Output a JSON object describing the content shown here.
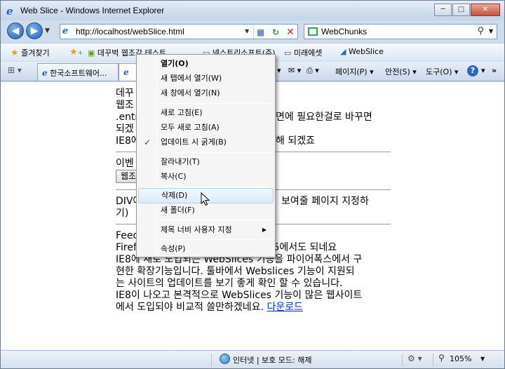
{
  "window": {
    "title": "Web Slice - Windows Internet Explorer",
    "min_label": "─",
    "max_label": "□",
    "close_label": "✕"
  },
  "nav": {
    "back_glyph": "◀",
    "fwd_glyph": "▶",
    "url": "http://localhost/webSlice.html",
    "search_provider": "WebChunks"
  },
  "favbar": {
    "favorites_label": "즐겨찾기",
    "items": [
      "데꾸벅 웹조각 테스트",
      "넥스트리소프트(주)",
      "미래에셋",
      "WebSlice"
    ]
  },
  "tabs": [
    {
      "label": "한국소프트웨어..."
    },
    {
      "label": ""
    }
  ],
  "commands": {
    "page": "페이지(P)",
    "safety": "안전(S)",
    "tools": "도구(O)",
    "help": "?"
  },
  "content": {
    "para1": [
      "데꾸",
      "웹조",
      ".entr",
      "되겠",
      "IE8에"
    ],
    "para1_right": [
      "면에 필요한걸로 바꾸면",
      "해 되겠죠"
    ],
    "para2": "이벤",
    "para2_btn": "웹조",
    "para3": [
      "DIV에",
      "기)"
    ],
    "para3_right": "보여줄 페이지 지정하",
    "para4": [
      "Feed",
      "Firef"
    ],
    "para4_right": ".5에서도 되네요",
    "para5": [
      "IE8에 새로 도입되는 WebSlices 기능을 파이어폭스에서 구",
      "현한 확장기능입니다. 툴바에서 Webslices 기능이 지원되",
      "는 사이트의 업데이트를 보기 좋게 확인 할 수 있습니다.",
      "IE8이 나오고 본격적으로 WebSlices 기능이 많은 웹사이트",
      "에서 도입되야 비교적 쓸만하겠네요."
    ],
    "download_link": "다운로드"
  },
  "context_menu": {
    "items": [
      {
        "label": "열기(O)",
        "bold": true
      },
      {
        "label": "새 탭에서 열기(W)"
      },
      {
        "label": "새 창에서 열기(N)"
      },
      {
        "label": "새로 고침(E)"
      },
      {
        "label": "모두 새로 고침(A)"
      },
      {
        "label": "업데이트 시 굵게(B)",
        "checked": true
      },
      {
        "label": "잘라내기(T)"
      },
      {
        "label": "복사(C)"
      },
      {
        "label": "삭제(D)",
        "highlighted": true
      },
      {
        "label": "새 폴더(F)"
      },
      {
        "label": "제목 너비 사용자 지정",
        "submenu": true
      },
      {
        "label": "속성(P)"
      }
    ]
  },
  "status": {
    "zone_text": "인터넷 | 보호 모드: 해제",
    "zoom": "105%"
  },
  "colors": {
    "accent": "#1e5fc2",
    "link": "#0033cc",
    "highlight_border": "#aecff7"
  }
}
